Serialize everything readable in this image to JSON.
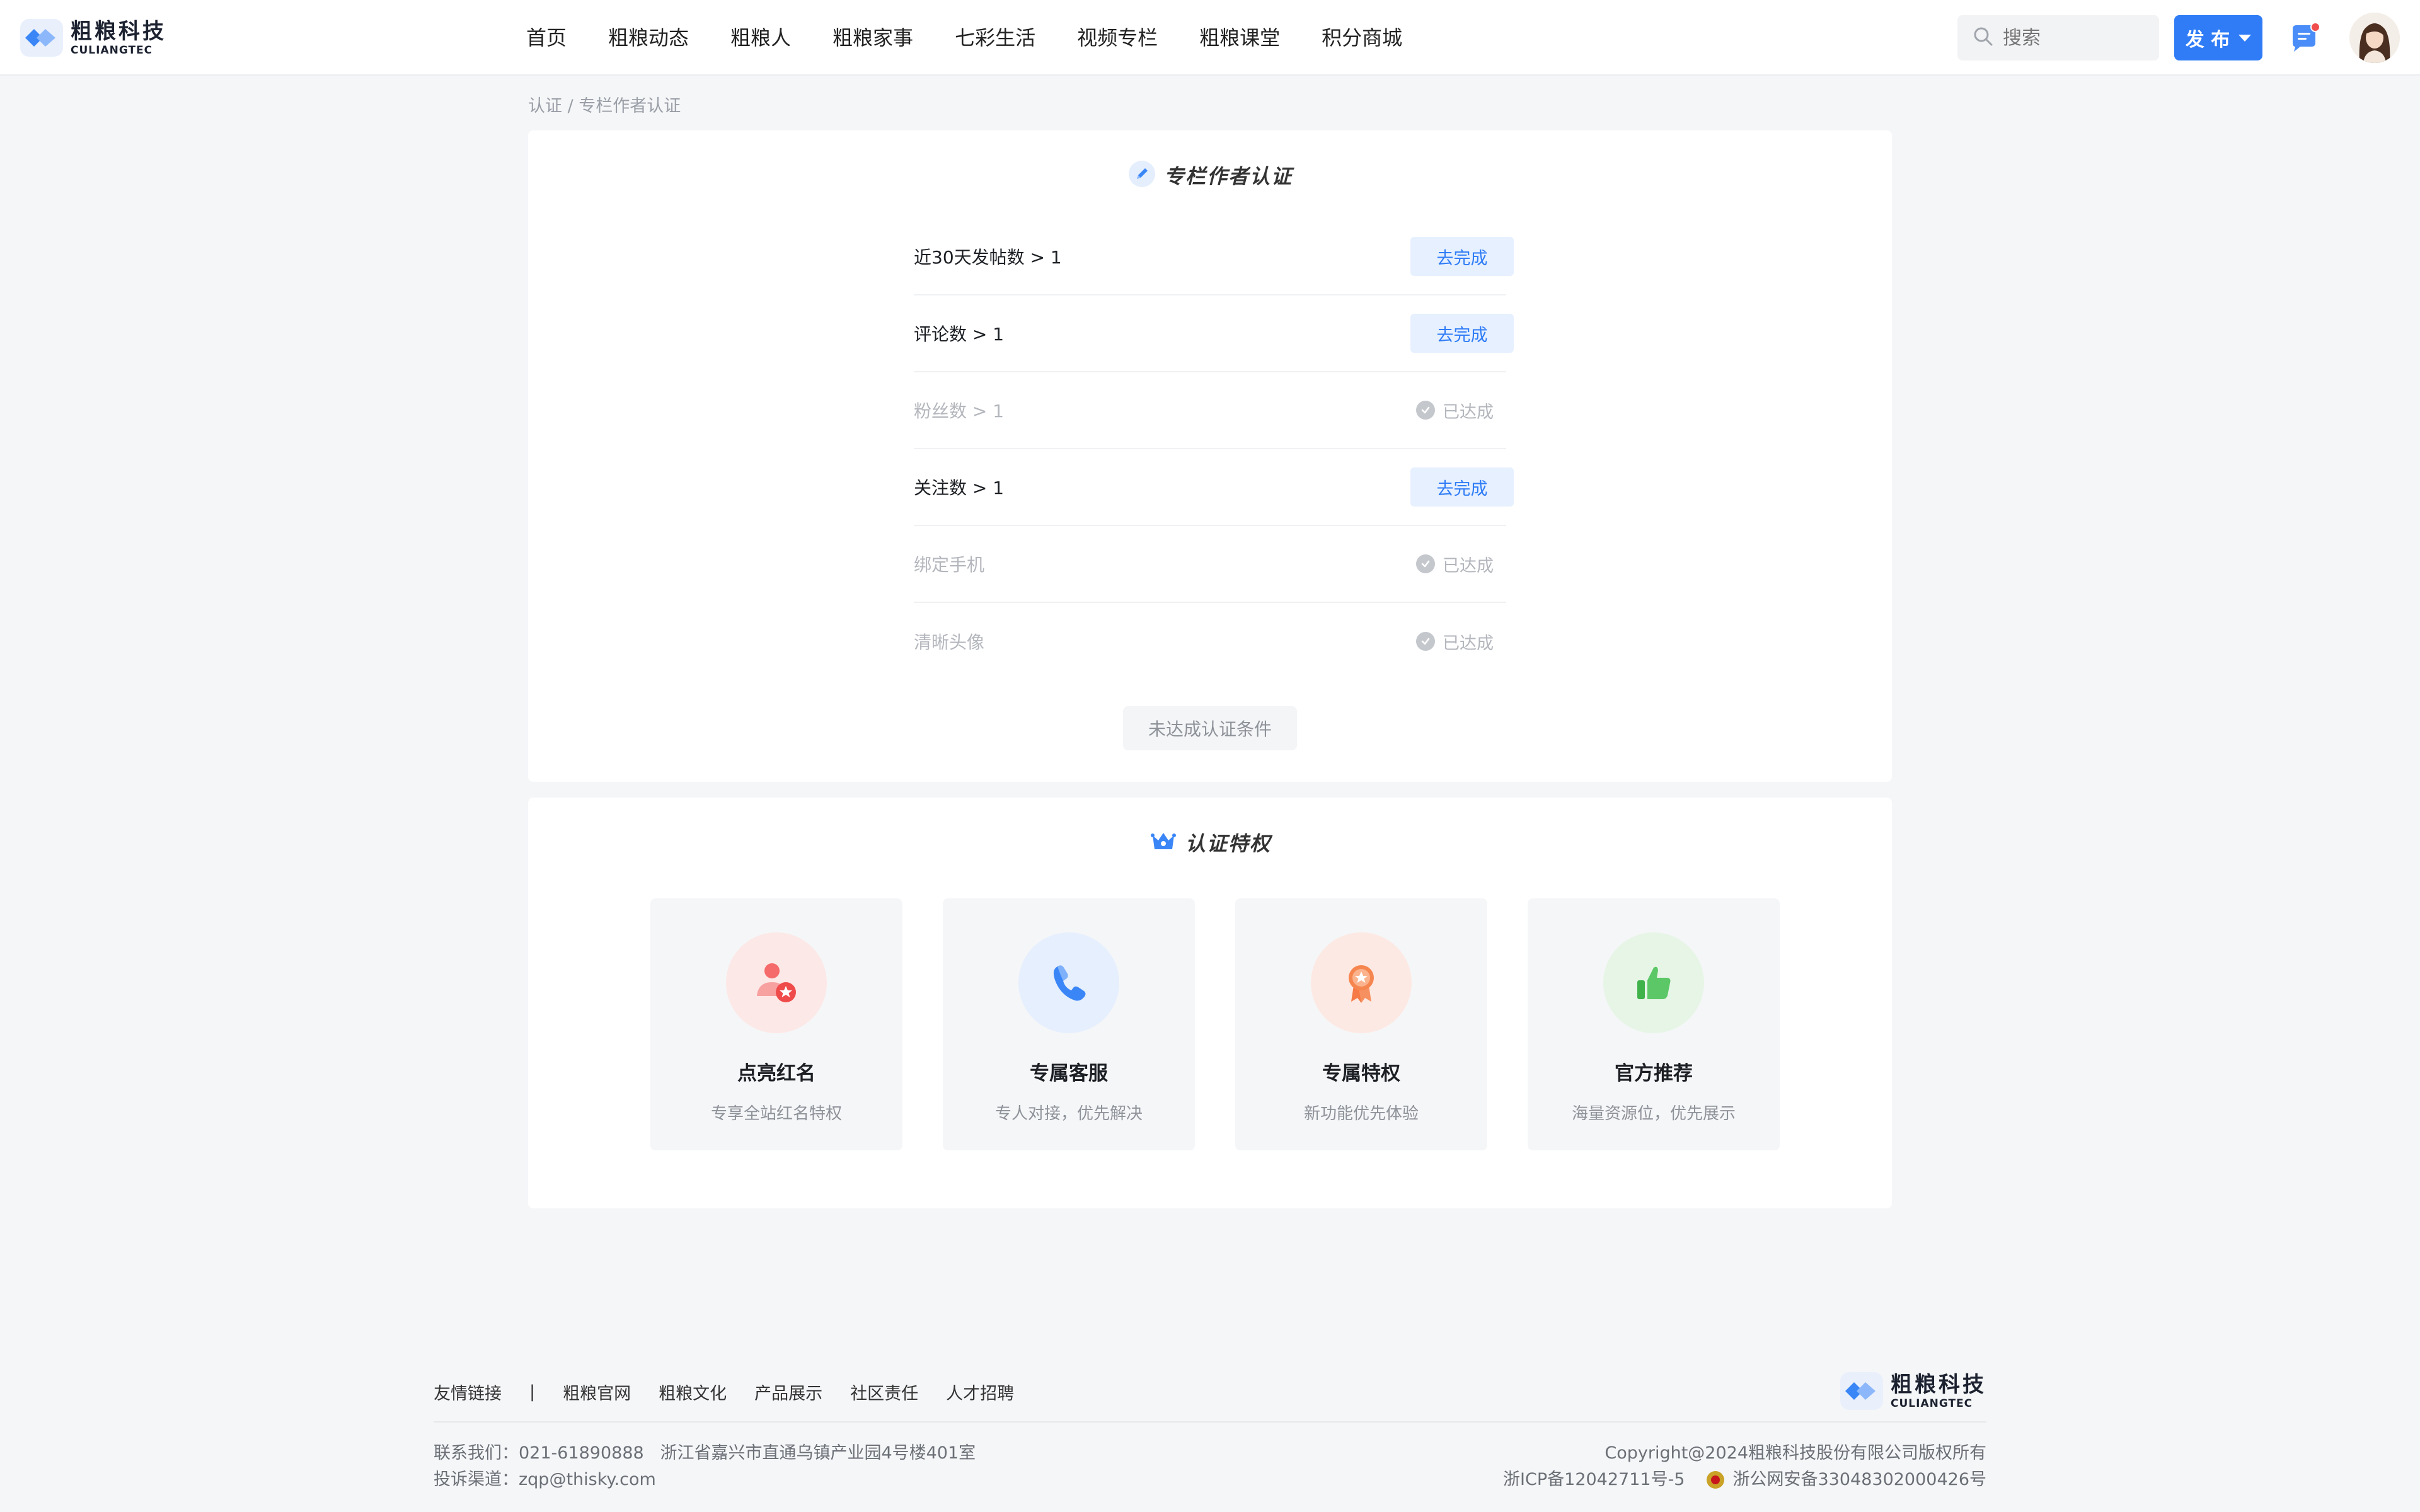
{
  "header": {
    "logo_cn": "粗粮科技",
    "logo_en": "CULIANGTEC",
    "nav": [
      "首页",
      "粗粮动态",
      "粗粮人",
      "粗粮家事",
      "七彩生活",
      "视频专栏",
      "粗粮课堂",
      "积分商城"
    ],
    "search_placeholder": "搜索",
    "publish_label": "发 布",
    "icons": {
      "search": "search-icon",
      "message": "message-icon",
      "avatar": "avatar"
    },
    "message_has_unread": true
  },
  "breadcrumb": "认证 / 专栏作者认证",
  "certification": {
    "title": "专栏作者认证",
    "conditions": [
      {
        "label": "近30天发帖数 > 1",
        "status": "去完成",
        "done": false
      },
      {
        "label": "评论数 > 1",
        "status": "去完成",
        "done": false
      },
      {
        "label": "粉丝数 > 1",
        "status": "已达成",
        "done": true
      },
      {
        "label": "关注数 > 1",
        "status": "去完成",
        "done": false
      },
      {
        "label": "绑定手机",
        "status": "已达成",
        "done": true
      },
      {
        "label": "清晰头像",
        "status": "已达成",
        "done": true
      }
    ],
    "submit_label": "未达成认证条件"
  },
  "privileges": {
    "title": "认证特权",
    "items": [
      {
        "title": "点亮红名",
        "desc": "专享全站红名特权",
        "icon": "user-star-icon",
        "color": "#fce8e6"
      },
      {
        "title": "专属客服",
        "desc": "专人对接，优先解决",
        "icon": "phone-icon",
        "color": "#e6effd"
      },
      {
        "title": "专属特权",
        "desc": "新功能优先体验",
        "icon": "medal-icon",
        "color": "#fde9e3"
      },
      {
        "title": "官方推荐",
        "desc": "海量资源位，优先展示",
        "icon": "thumbs-up-icon",
        "color": "#e6f5e6"
      }
    ]
  },
  "footer": {
    "links_title": "友情链接",
    "links": [
      "粗粮官网",
      "粗粮文化",
      "产品展示",
      "社区责任",
      "人才招聘"
    ],
    "contact": "联系我们：021-61890888   浙江省嘉兴市直通乌镇产业园4号楼401室",
    "complaint": "投诉渠道：zqp@thisky.com",
    "copyright": "Copyright@2024粗粮科技股份有限公司版权所有",
    "icp": "浙ICP备12042711号-5",
    "police": "浙公网安备33048302000426号",
    "logo_cn": "粗粮科技",
    "logo_en": "CULIANGTEC"
  }
}
